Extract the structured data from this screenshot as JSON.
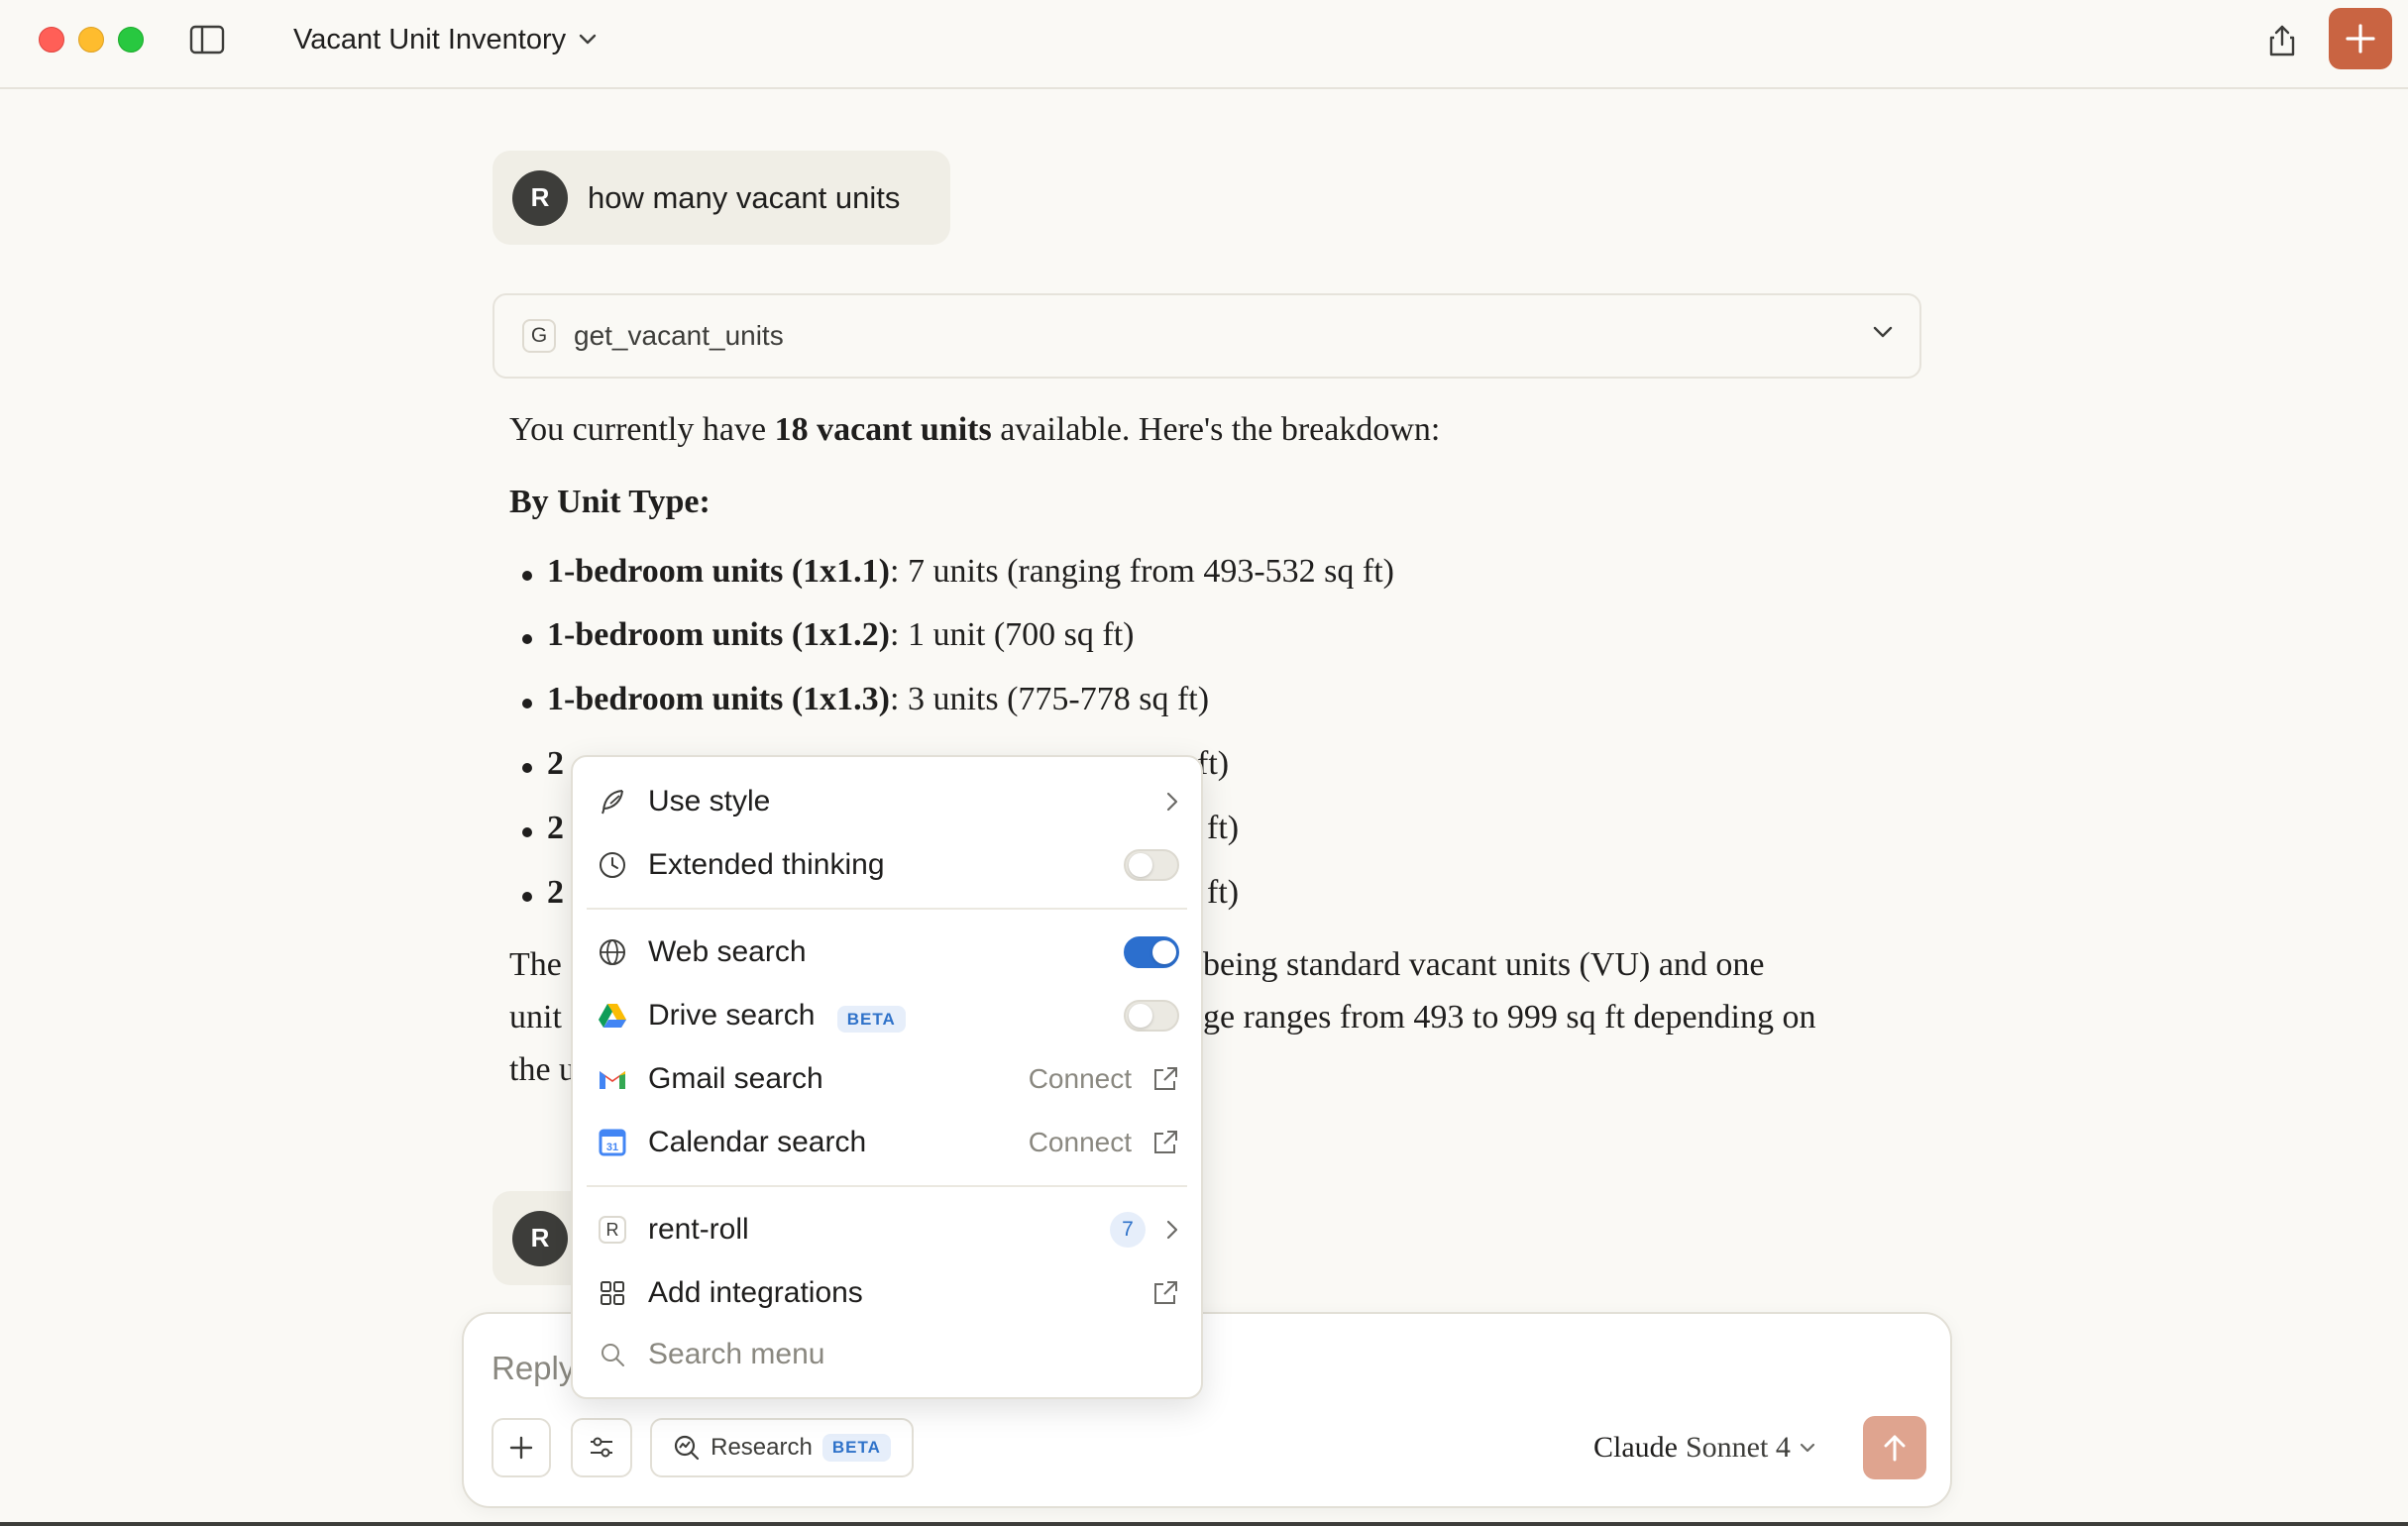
{
  "window": {
    "title": "Vacant Unit Inventory"
  },
  "messages": {
    "user1": {
      "avatar": "R",
      "text": "how many vacant units"
    },
    "tool_call": {
      "badge": "G",
      "name": "get_vacant_units"
    },
    "assistant": {
      "intro_pre": "You currently have ",
      "intro_bold": "18 vacant units",
      "intro_post": " available. Here's the breakdown:",
      "heading": "By Unit Type:",
      "bullets": [
        {
          "bold": "1-bedroom units (1x1.1)",
          "text": ": 7 units (ranging from 493-532 sq ft)"
        },
        {
          "bold": "1-bedroom units (1x1.2)",
          "text": ": 1 unit (700 sq ft)"
        },
        {
          "bold": "1-bedroom units (1x1.3)",
          "text": ": 3 units (775-778 sq ft)"
        },
        {
          "visible_start": "2",
          "visible_end": "ft)"
        },
        {
          "visible_start": "2",
          "visible_end": "ft)"
        },
        {
          "visible_start": "2",
          "visible_end": "ft)"
        }
      ],
      "para_lines": [
        {
          "start": "The",
          "end": "being standard vacant units (VU) and one"
        },
        {
          "start": "unit",
          "end": "ge ranges from 493 to 999 sq ft depending on"
        },
        {
          "start": "the u",
          "end": ""
        }
      ]
    },
    "user2": {
      "avatar": "R"
    }
  },
  "composer": {
    "placeholder": "Reply to Claude...",
    "research_label": "Research",
    "research_badge": "BETA",
    "model_name_1": "Claude",
    "model_name_2": "Sonnet 4"
  },
  "menu": {
    "use_style": "Use style",
    "extended_thinking": {
      "label": "Extended thinking",
      "enabled": false
    },
    "web_search": {
      "label": "Web search",
      "enabled": true
    },
    "drive_search": {
      "label": "Drive search",
      "badge": "BETA",
      "enabled": false
    },
    "gmail_search": {
      "label": "Gmail search",
      "action": "Connect"
    },
    "calendar_search": {
      "label": "Calendar search",
      "action": "Connect"
    },
    "rent_roll": {
      "badge": "R",
      "label": "rent-roll",
      "count": "7"
    },
    "add_integrations": "Add integrations",
    "search_placeholder": "Search menu"
  },
  "colors": {
    "accent": "#c96442",
    "toggle_on": "#2c6fce",
    "background": "#faf9f5"
  }
}
